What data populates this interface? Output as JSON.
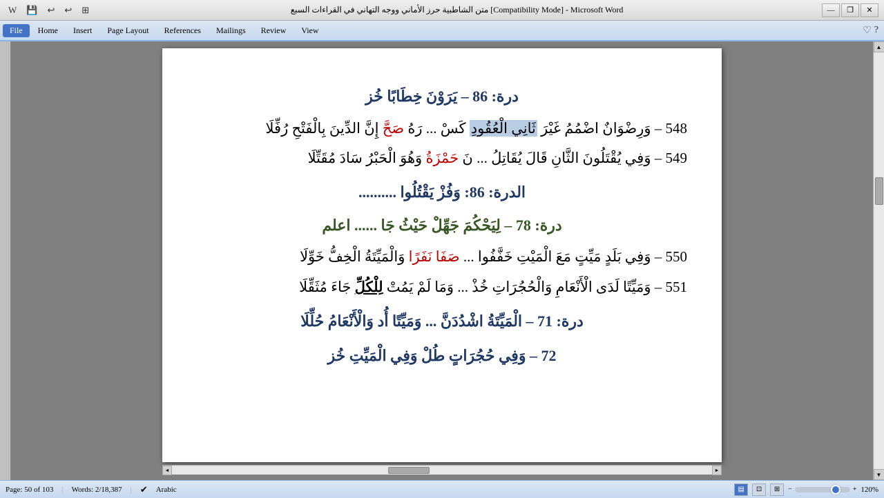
{
  "titlebar": {
    "title": "متن الشاطبية حرز الأماني ووجه التهاني في القراءات السبع [Compatibility Mode] - Microsoft Word",
    "minimize": "—",
    "restore": "❐",
    "close": "✕"
  },
  "quickaccess": {
    "icons": [
      "💾",
      "↩",
      "↩",
      "⊞"
    ]
  },
  "menu": {
    "items": [
      "File",
      "Home",
      "Insert",
      "Page Layout",
      "References",
      "Mailings",
      "Review",
      "View"
    ],
    "active_index": 0
  },
  "document": {
    "heading1": "درة: 86 – يَرَوْنَ خِطَابًا خُز",
    "verse548": "548 – وَرِضْوَانٌ اضْمُمُ غَيْرَ ثَانِي الْعُقُودِ كَسْ ... رَهُ صَحَّ إِنَّ الدِّينَ بِالْفَتْحِ رُفِّلَا",
    "verse548_highlight": "ثَانِي الْعُقُودِ",
    "verse549": "549 – وَفِي يُقْتَلُونَ الثَّانِ قَالَ يُقَاتِلُ ... نَ حَمْزَةُ وَهُوَ الْحَبْرُ سَادَ مُقَتِّلَا",
    "verse549_red": "حَمْزَةُ",
    "heading2": "الدرة: 86: وَفُزْ يَقْتُلُوا ..........",
    "heading3": "درة: 78 – لِيَحْكُمَ جَهِّلْ حَيْثُ جَا ...... اعلم",
    "verse550": "550 – وَفِي بَلَدٍ مَيِّتٍ مَعَ الْمَيْتِ خَفَّفُوا ... صَفَا نَفَرًا وَالْمَيِّتَةُ الْخِفُّ خَوِّلَا",
    "verse550_red": "صَفَا نَفَرًا",
    "verse551": "551 – وَمَيِّتًا لَدَى الْأَنْعَامِ وَالْحُجُرَاتِ خُذْ ... وَمَا لَمْ يَمُتْ لِلْكُلِّ جَاءَ مُثَقِّلَا",
    "verse551_bold": "لِلْكُلِّ",
    "heading4": "درة: 71 – الْمَيِّتَةُ اشْدُدَنَّ ... وَمَيِّتًا أُد وَالْأَنْعَامُ حُلِّلَا",
    "verse72": "72 – وَفِي حُجُرَاتٍ طُلْ وَفِي الْمَيِّتِ خُز"
  },
  "statusbar": {
    "page": "Page: 50 of 103",
    "words": "Words: 2/18,387",
    "language": "Arabic",
    "zoom": "120%"
  },
  "icons": {
    "help": "?",
    "ribbon_collapse": "∧",
    "scroll_up": "▲",
    "scroll_down": "▼",
    "scroll_left": "◄",
    "scroll_right": "►"
  }
}
